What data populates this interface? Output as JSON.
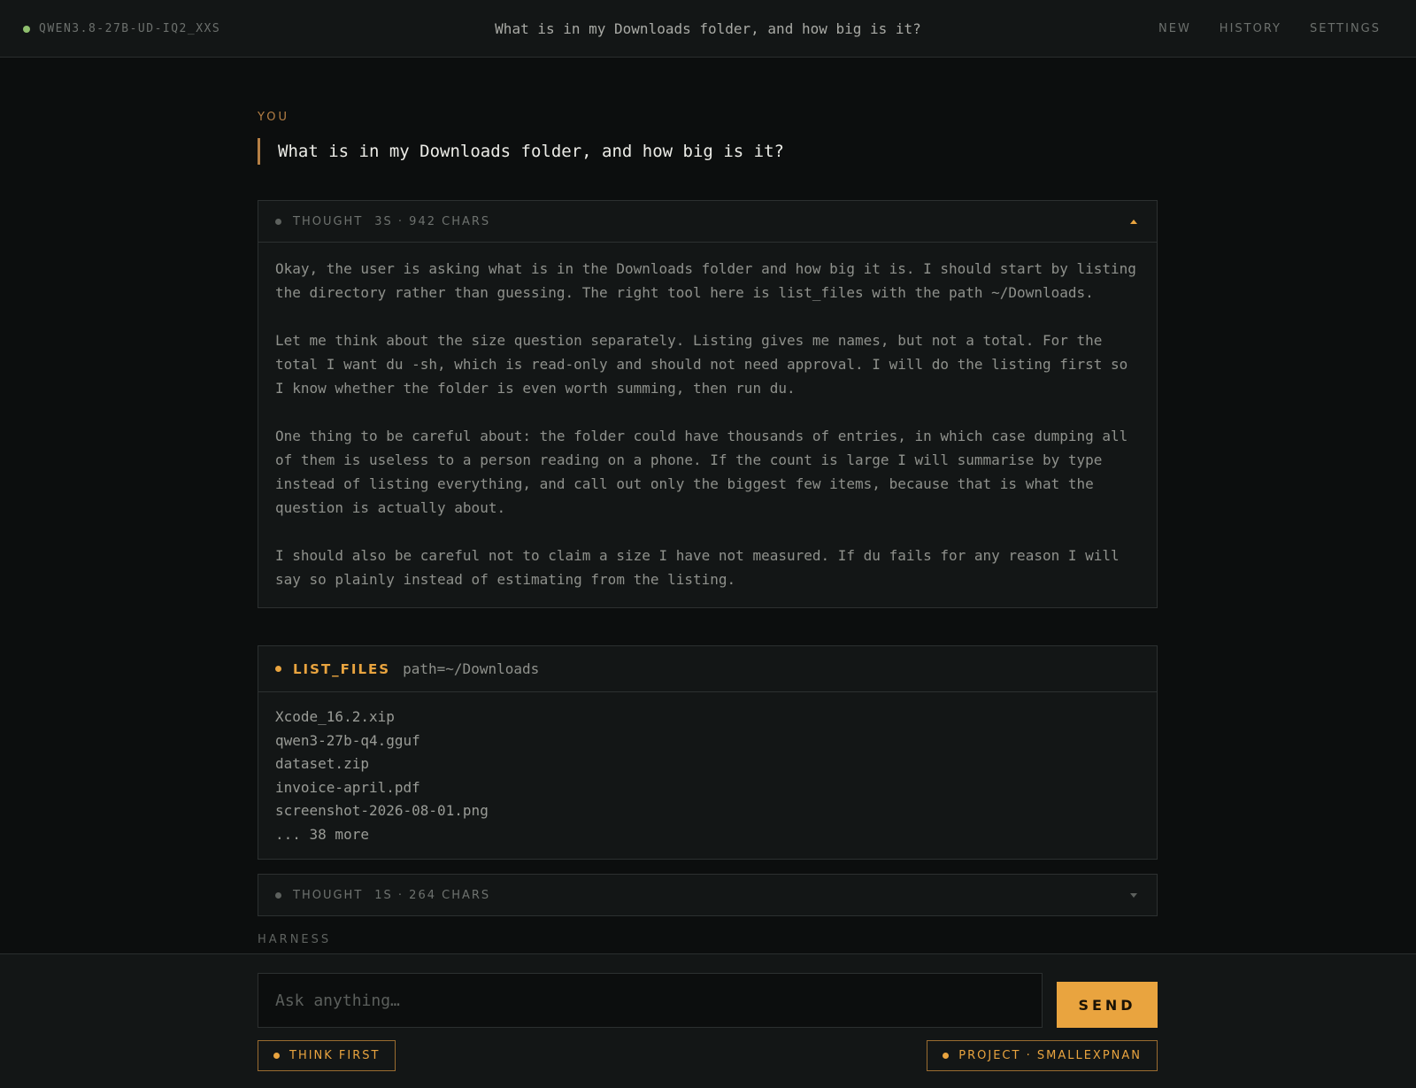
{
  "header": {
    "model": "QWEN3.8-27B-UD-IQ2_XXS",
    "title": "What is in my Downloads folder, and how big is it?",
    "nav": [
      "NEW",
      "HISTORY",
      "SETTINGS"
    ]
  },
  "conversation": {
    "you_label": "YOU",
    "user_message": "What is in my Downloads folder, and how big is it?",
    "thought1": {
      "label": "THOUGHT",
      "meta": "3S · 942 CHARS",
      "paragraphs": [
        "Okay, the user is asking what is in the Downloads folder and how big it is. I should start by listing the directory rather than guessing. The right tool here is list_files with the path ~/Downloads.",
        "Let me think about the size question separately. Listing gives me names, but not a total. For the total I want du -sh, which is read-only and should not need approval. I will do the listing first so I know whether the folder is even worth summing, then run du.",
        "One thing to be careful about: the folder could have thousands of entries, in which case dumping all of them is useless to a person reading on a phone. If the count is large I will summarise by type instead of listing everything, and call out only the biggest few items, because that is what the question is actually about.",
        "I should also be careful not to claim a size I have not measured. If du fails for any reason I will say so plainly instead of estimating from the listing."
      ]
    },
    "tool": {
      "name": "LIST_FILES",
      "arg": "path=~/Downloads",
      "output": [
        "Xcode_16.2.xip",
        "qwen3-27b-q4.gguf",
        "dataset.zip",
        "invoice-april.pdf",
        "screenshot-2026-08-01.png",
        "... 38 more"
      ]
    },
    "thought2": {
      "label": "THOUGHT",
      "meta": "1S · 264 CHARS"
    },
    "harness_label": "HARNESS"
  },
  "composer": {
    "placeholder": "Ask anything…",
    "send_label": "SEND",
    "think_chip": "THINK FIRST",
    "project_chip": "PROJECT · SMALLEXPNAN"
  },
  "colors": {
    "accent": "#e9a43f",
    "status_dot": "#8fbf6e",
    "background": "#0c0e0e"
  }
}
